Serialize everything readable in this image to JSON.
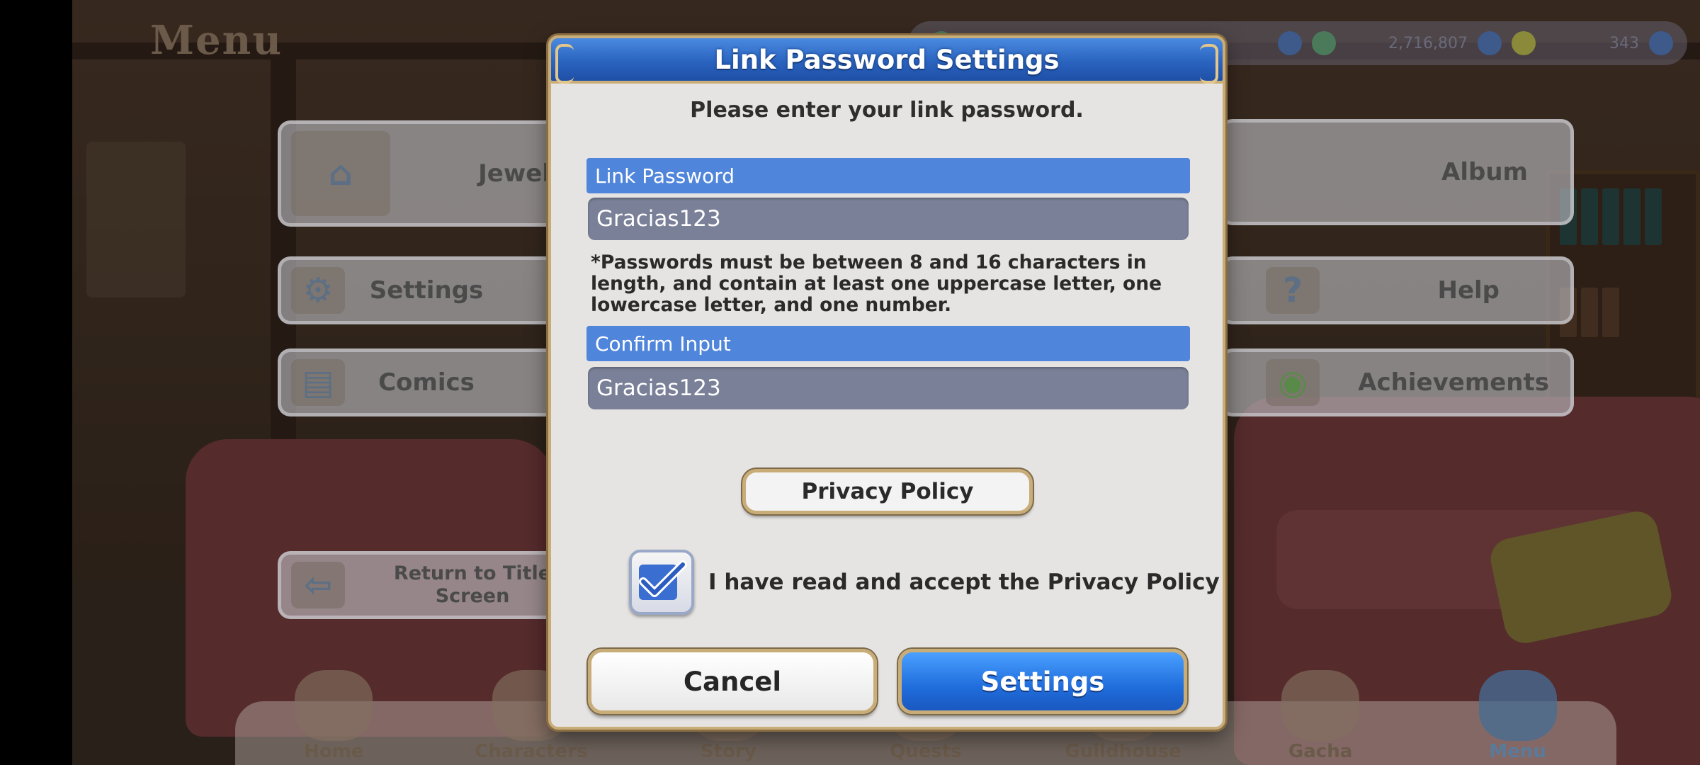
{
  "background": {
    "menu_title": "Menu",
    "status_bar": {
      "coins_value": "2,716,807",
      "gems_value": "343"
    },
    "menu_left": [
      {
        "label": "Jewel",
        "icon": "shop-icon"
      },
      {
        "label": "Settings",
        "icon": "gear-icon"
      },
      {
        "label": "Comics",
        "icon": "book-icon"
      },
      {
        "label": "Return to Title Screen",
        "icon": "door-icon"
      }
    ],
    "menu_right": [
      {
        "label": "Album",
        "icon": "album-icon"
      },
      {
        "label": "Help",
        "icon": "question-icon"
      },
      {
        "label": "Achievements",
        "icon": "gamepad-icon"
      }
    ],
    "bottom_nav": [
      {
        "label": "Home"
      },
      {
        "label": "Characters"
      },
      {
        "label": "Story"
      },
      {
        "label": "Quests"
      },
      {
        "label": "Guildhouse"
      },
      {
        "label": "Gacha"
      },
      {
        "label": "Menu"
      }
    ]
  },
  "dialog": {
    "title": "Link Password Settings",
    "subtitle": "Please enter your link password.",
    "password_label": "Link Password",
    "password_value": "Gracias123",
    "password_note": "*Passwords must be between 8 and 16 characters in length, and contain at least one uppercase letter, one lowercase letter, and one number.",
    "confirm_label": "Confirm Input",
    "confirm_value": "Gracias123",
    "privacy_button": "Privacy Policy",
    "accept_label": "I have read and accept the Privacy Policy",
    "accept_checked": true,
    "cancel_button": "Cancel",
    "settings_button": "Settings"
  },
  "colors": {
    "header_blue": "#2a64c0",
    "field_label_blue": "#4f85da",
    "input_gray": "#7a8098",
    "gold_border": "#c9ad79",
    "settings_blue": "#1f6ddc"
  }
}
